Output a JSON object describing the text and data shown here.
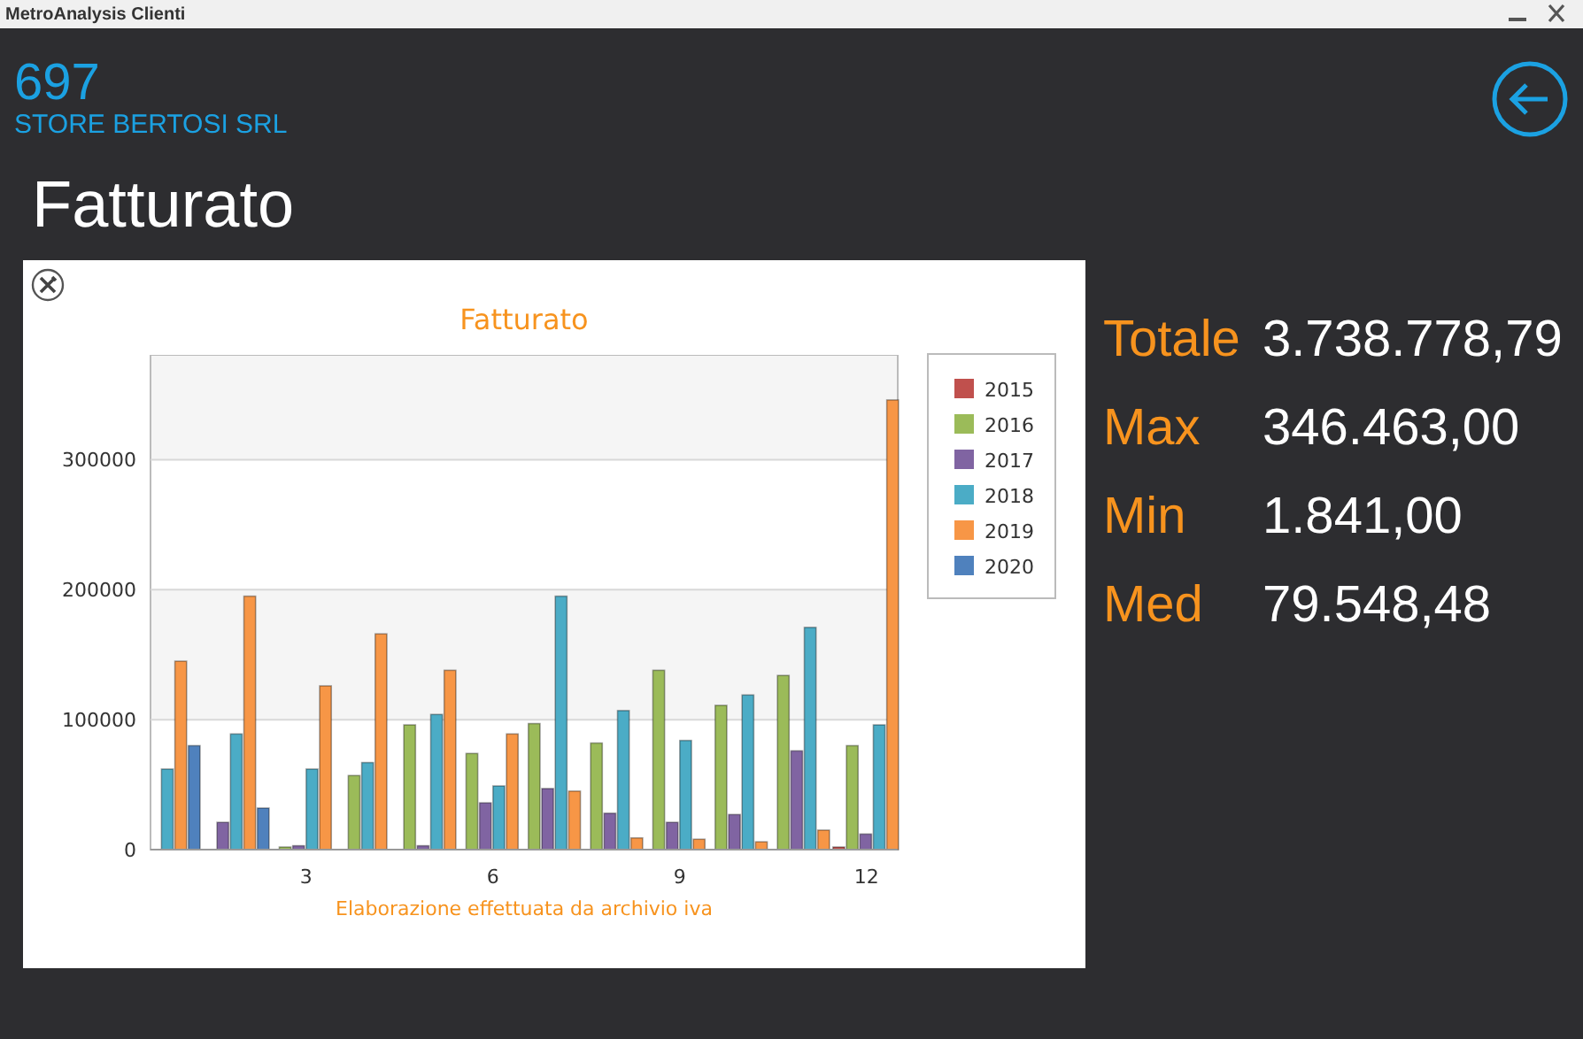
{
  "window": {
    "title": "MetroAnalysis Clienti"
  },
  "customer": {
    "code": "697",
    "name": "STORE BERTOSI SRL"
  },
  "page_title": "Fatturato",
  "chart": {
    "chart_data": {
      "type": "bar",
      "title": "Fatturato",
      "xlabel": "Elaborazione effettuata da archivio iva",
      "x": [
        1,
        2,
        3,
        4,
        5,
        6,
        7,
        8,
        9,
        10,
        11,
        12
      ],
      "xticks": [
        3,
        6,
        9,
        12
      ],
      "xlim": [
        0.5,
        12.5
      ],
      "ylim": [
        0,
        380000
      ],
      "yticks": [
        0,
        100000,
        200000,
        300000
      ],
      "grid": true,
      "legend": true,
      "series": [
        {
          "name": "2015",
          "color": "#c0504d",
          "values": [
            null,
            null,
            null,
            null,
            null,
            null,
            null,
            null,
            null,
            null,
            null,
            2000
          ]
        },
        {
          "name": "2016",
          "color": "#9bbb59",
          "values": [
            null,
            null,
            2000,
            57000,
            96000,
            74000,
            97000,
            82000,
            138000,
            111000,
            134000,
            80000
          ]
        },
        {
          "name": "2017",
          "color": "#8064a2",
          "values": [
            null,
            21000,
            3000,
            null,
            3000,
            36000,
            47000,
            28000,
            21000,
            27000,
            76000,
            12000
          ]
        },
        {
          "name": "2018",
          "color": "#4bacc6",
          "values": [
            62000,
            89000,
            62000,
            67000,
            104000,
            49000,
            195000,
            107000,
            84000,
            119000,
            171000,
            96000
          ]
        },
        {
          "name": "2019",
          "color": "#f79646",
          "values": [
            145000,
            195000,
            126000,
            166000,
            138000,
            89000,
            45000,
            9000,
            8000,
            6000,
            15000,
            346000
          ]
        },
        {
          "name": "2020",
          "color": "#4f81bd",
          "values": [
            80000,
            32000,
            null,
            null,
            null,
            null,
            null,
            null,
            null,
            null,
            null,
            null
          ]
        }
      ]
    }
  },
  "stats": [
    {
      "label": "Totale",
      "value": "3.738.778,79"
    },
    {
      "label": "Max",
      "value": "346.463,00"
    },
    {
      "label": "Min",
      "value": "1.841,00"
    },
    {
      "label": "Med",
      "value": "79.548,48"
    }
  ]
}
